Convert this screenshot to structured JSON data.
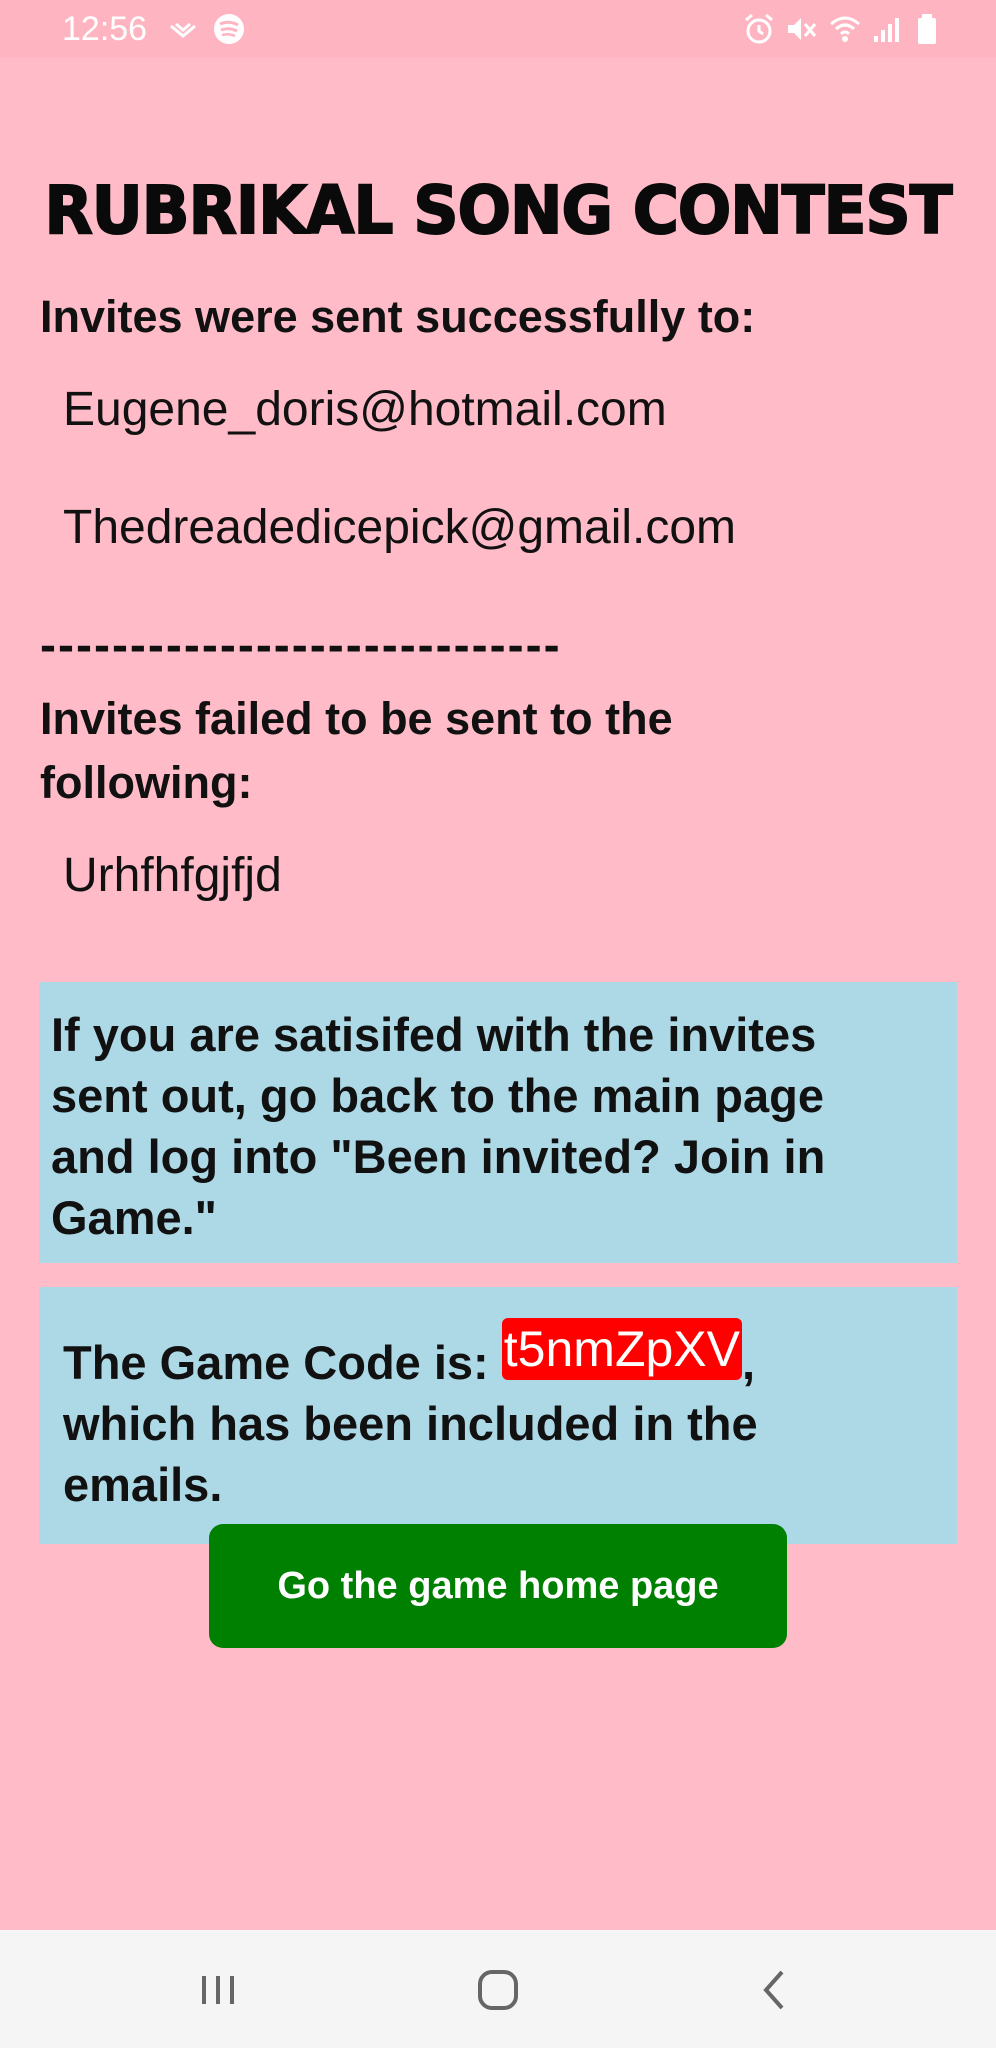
{
  "status_bar": {
    "time": "12:56",
    "left_icons": [
      "signal-broadcast-icon",
      "spotify-icon"
    ],
    "right_icons": [
      "alarm-icon",
      "mute-icon",
      "wifi-icon",
      "cell-signal-icon",
      "battery-icon"
    ]
  },
  "app": {
    "title": "RUBRIKAL SONG CONTEST"
  },
  "success": {
    "heading": "Invites were sent successfully to:",
    "emails": [
      "Eugene_doris@hotmail.com",
      "Thedreadedicepick@gmail.com"
    ]
  },
  "divider": "-----------------------------",
  "failed": {
    "heading_line1": "Invites failed to be sent to the",
    "heading_line2": "following:",
    "entries": [
      "Urhfhfgjfjd"
    ]
  },
  "instructions": {
    "line1": "If you are satisifed with the invites",
    "line2": "sent out, go back to the main page",
    "line3": "and log into \"Been invited? Join in",
    "line4": "Game.\""
  },
  "game_code": {
    "prefix": "The Game Code is: ",
    "code": "t5nmZpXV",
    "suffix": ",",
    "line2": "which has been included in the",
    "line3": "emails."
  },
  "button": {
    "label": "Go the game home page"
  },
  "colors": {
    "background": "#ffbcc8",
    "info_box": "#add8e6",
    "code_badge": "#ff0000",
    "button": "#008000"
  },
  "nav": {
    "icons": [
      "recent-apps-icon",
      "home-icon",
      "back-icon"
    ]
  }
}
